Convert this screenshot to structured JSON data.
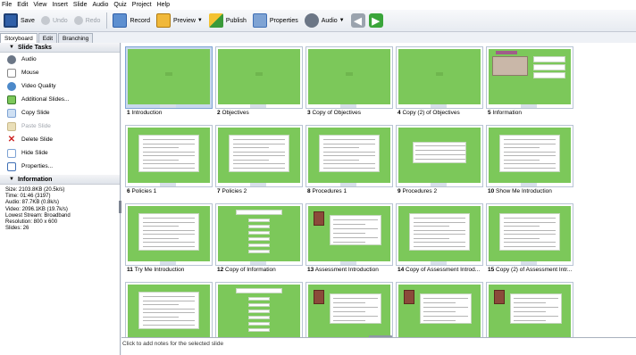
{
  "menu": [
    "File",
    "Edit",
    "View",
    "Insert",
    "Slide",
    "Audio",
    "Quiz",
    "Project",
    "Help"
  ],
  "toolbar": {
    "save": "Save",
    "undo": "Undo",
    "redo": "Redo",
    "record": "Record",
    "preview": "Preview",
    "publish": "Publish",
    "properties": "Properties",
    "audio": "Audio"
  },
  "tabs": [
    "Storyboard",
    "Edit",
    "Branching"
  ],
  "slide_tasks": {
    "title": "Slide Tasks",
    "items": [
      {
        "label": "Audio",
        "icon": "audio-icon"
      },
      {
        "label": "Mouse",
        "icon": "mouse-icon"
      },
      {
        "label": "Video Quality",
        "icon": "video-quality-icon"
      },
      {
        "label": "Additional Slides...",
        "icon": "additional-slides-icon"
      },
      {
        "label": "Copy Slide",
        "icon": "copy-slide-icon"
      },
      {
        "label": "Paste Slide",
        "icon": "paste-slide-icon"
      },
      {
        "label": "Delete Slide",
        "icon": "delete-slide-icon"
      },
      {
        "label": "Hide Slide",
        "icon": "hide-slide-icon"
      },
      {
        "label": "Properties...",
        "icon": "properties-icon"
      }
    ]
  },
  "information": {
    "title": "Information",
    "lines": [
      "Size: 2103.8KB (20.5k/s)",
      "Time: 01:46 (3197)",
      "Audio: 87.7KB (0.8k/s)",
      "Video: 2096.1KB (19.7k/s)",
      "Lowest Stream: Broadband",
      "Resolution: 800 x 600",
      "Slides: 26"
    ]
  },
  "slides": [
    {
      "num": "1",
      "title": "Introduction"
    },
    {
      "num": "2",
      "title": "Objectives"
    },
    {
      "num": "3",
      "title": "Copy of Objectives"
    },
    {
      "num": "4",
      "title": "Copy (2) of Objectives"
    },
    {
      "num": "5",
      "title": "Information"
    },
    {
      "num": "6",
      "title": "Policies 1"
    },
    {
      "num": "7",
      "title": "Policies 2"
    },
    {
      "num": "8",
      "title": "Procedures 1"
    },
    {
      "num": "9",
      "title": "Procedures 2"
    },
    {
      "num": "10",
      "title": "Show Me Introduction"
    },
    {
      "num": "11",
      "title": "Try Me Introduction"
    },
    {
      "num": "12",
      "title": "Copy of Information"
    },
    {
      "num": "13",
      "title": "Assessment Introduction"
    },
    {
      "num": "14",
      "title": "Copy of Assessment Introd..."
    },
    {
      "num": "15",
      "title": "Copy (2) of Assessment Intr..."
    },
    {
      "num": "",
      "title": ""
    },
    {
      "num": "",
      "title": ""
    },
    {
      "num": "",
      "title": ""
    },
    {
      "num": "",
      "title": ""
    },
    {
      "num": "",
      "title": ""
    }
  ],
  "notes_placeholder": "Click to add notes for the selected slide",
  "colors": {
    "slide_green": "#7cc85a",
    "selected_bg": "#c9d9ee",
    "accent_blue": "#3f6fb5"
  }
}
